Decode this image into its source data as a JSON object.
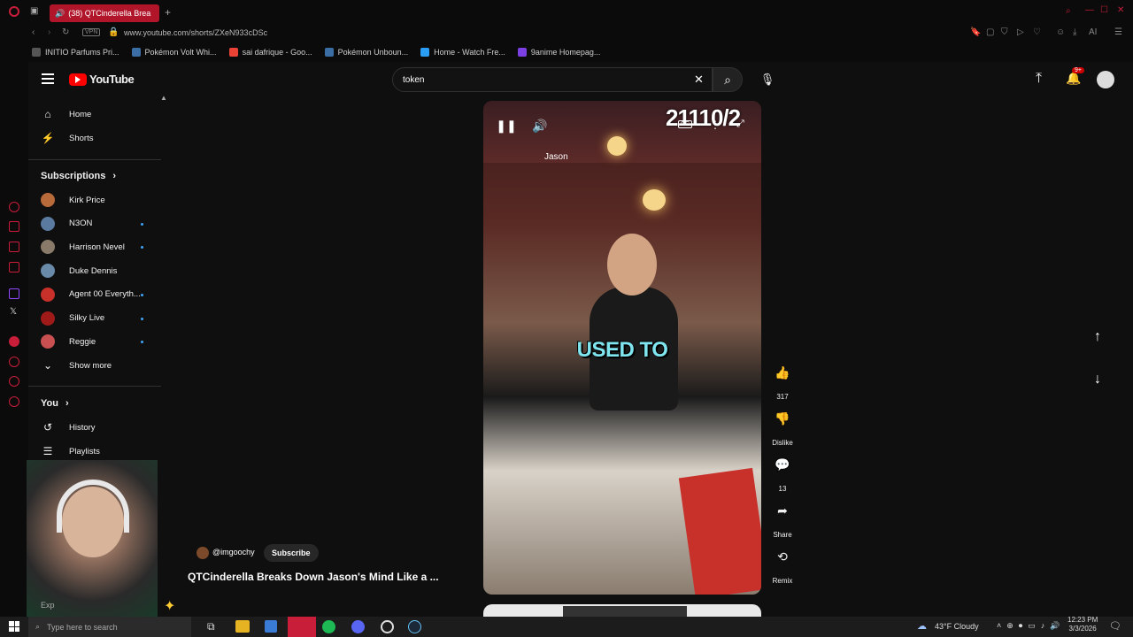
{
  "browser": {
    "tab_title": "(38) QTCinderella Brea",
    "url": "www.youtube.com/shorts/ZXeN933cDSc",
    "vpn_label": "VPN",
    "ai_label": "AI",
    "bookmarks": [
      {
        "label": "INITIO Parfums Pri...",
        "color": "#555555"
      },
      {
        "label": "Pokémon Volt Whi...",
        "color": "#3a6ea5"
      },
      {
        "label": "sai dafrique - Goo...",
        "color": "#ea4335"
      },
      {
        "label": "Pokémon Unboun...",
        "color": "#3a6ea5"
      },
      {
        "label": "Home - Watch Fre...",
        "color": "#2a9df4"
      },
      {
        "label": "9anime Homepag...",
        "color": "#7b3fe4"
      }
    ]
  },
  "youtube": {
    "logo_text": "YouTube",
    "search_value": "token",
    "notification_count": "9+",
    "sidebar": {
      "main": [
        {
          "label": "Home",
          "icon": "home-icon"
        },
        {
          "label": "Shorts",
          "icon": "shorts-icon"
        }
      ],
      "subscriptions_title": "Subscriptions",
      "subscriptions": [
        {
          "label": "Kirk Price",
          "color": "#b86a3a",
          "new": false
        },
        {
          "label": "N3ON",
          "color": "#5a7aa0",
          "new": true
        },
        {
          "label": "Harrison Nevel",
          "color": "#8a7a6a",
          "new": true
        },
        {
          "label": "Duke Dennis",
          "color": "#6a8aaa",
          "new": false
        },
        {
          "label": "Agent 00 Everyth...",
          "color": "#c8302a",
          "new": true
        },
        {
          "label": "Silky Live",
          "color": "#a01a1a",
          "new": true
        },
        {
          "label": "Reggie",
          "color": "#c85050",
          "new": true
        }
      ],
      "show_more": "Show more",
      "you_title": "You",
      "you_items": [
        {
          "label": "History",
          "icon": "history-icon"
        },
        {
          "label": "Playlists",
          "icon": "playlists-icon"
        }
      ],
      "partial_label": "Exp"
    },
    "short": {
      "counter_text": "21110/2",
      "speaker_label": "Jason",
      "caption": "USED TO",
      "channel_handle": "@imgoochy",
      "subscribe_label": "Subscribe",
      "title": "QTCinderella Breaks Down Jason's Mind Like a ...",
      "cc_label": "CC"
    },
    "actions": {
      "like_count": "317",
      "dislike_label": "Dislike",
      "comment_count": "13",
      "share_label": "Share",
      "remix_label": "Remix"
    }
  },
  "taskbar": {
    "search_placeholder": "Type here to search",
    "weather": "43°F  Cloudy",
    "time": "12:23 PM",
    "date": "3/3/2026"
  }
}
